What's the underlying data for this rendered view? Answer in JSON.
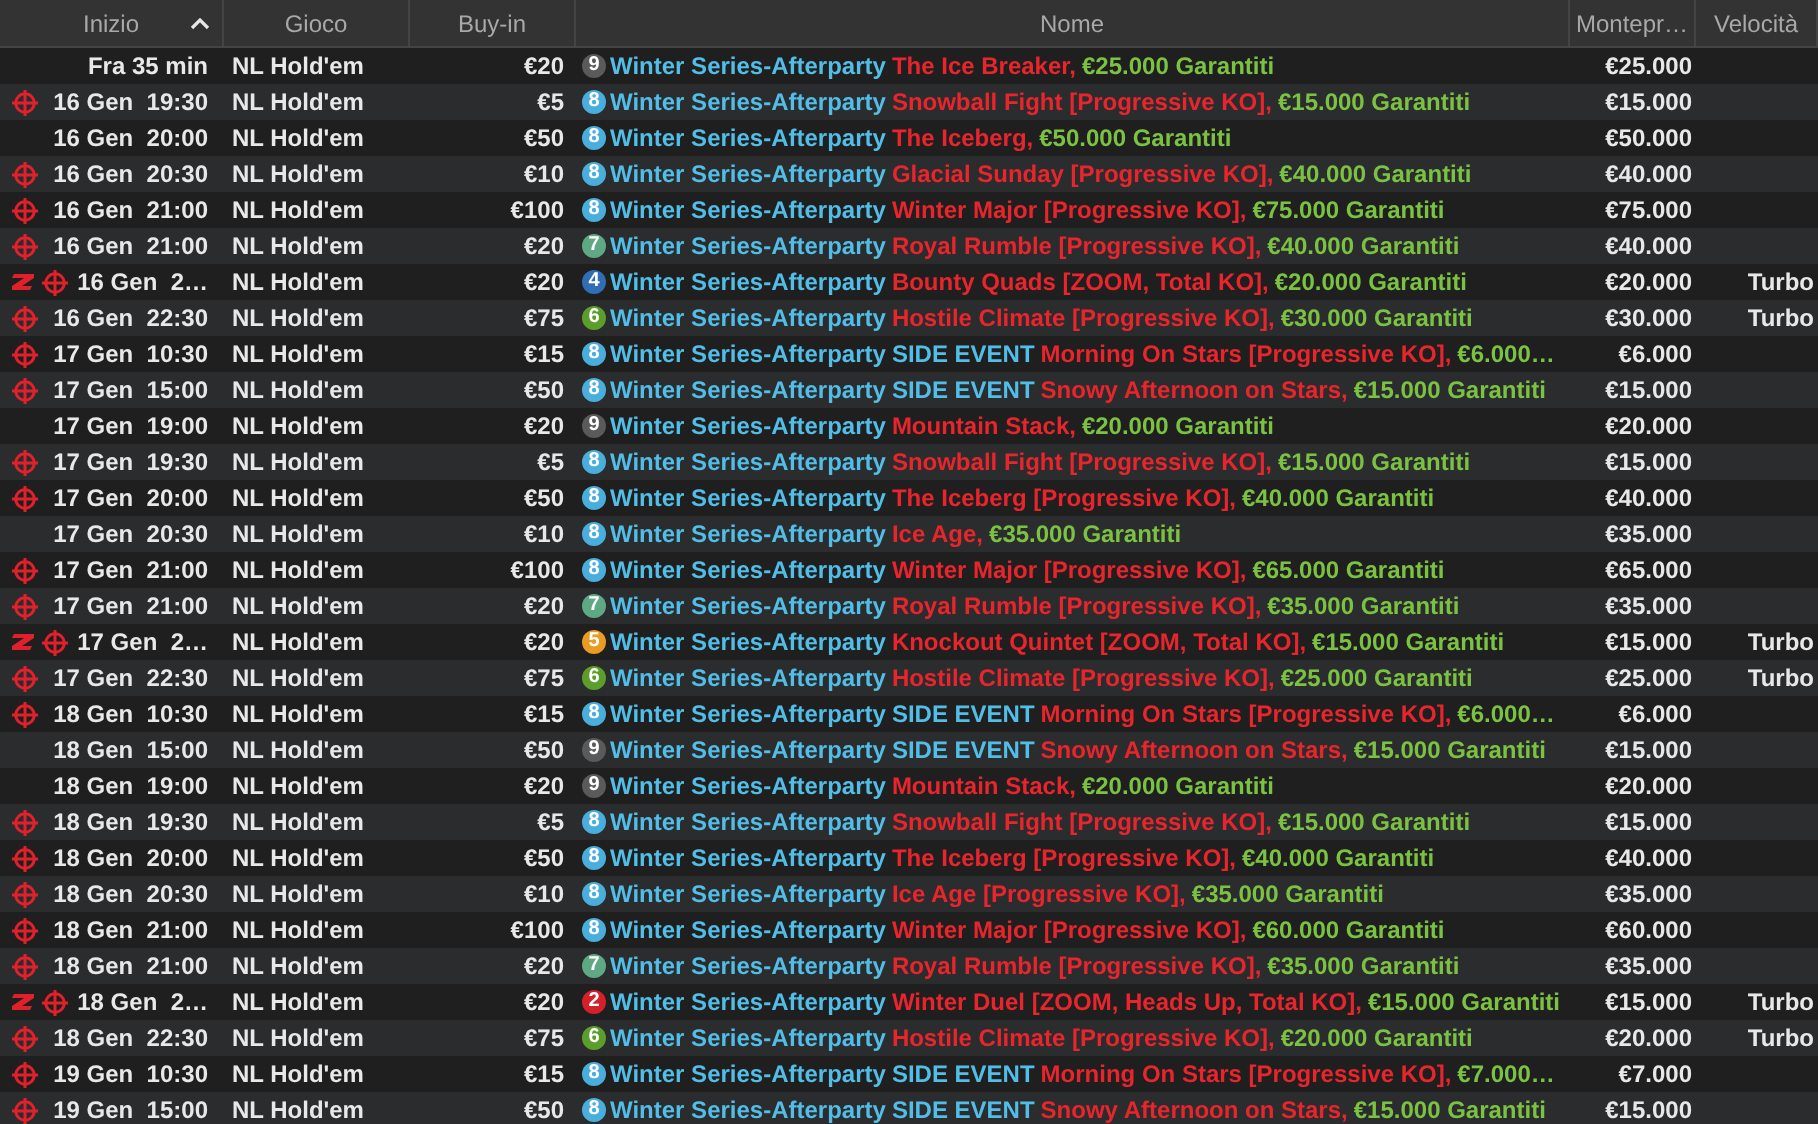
{
  "columns": [
    {
      "label": "Inizio",
      "sorted": true
    },
    {
      "label": "Gioco"
    },
    {
      "label": "Buy-in"
    },
    {
      "label": "Nome"
    },
    {
      "label": "Montepr…"
    },
    {
      "label": "Velocità"
    }
  ],
  "rows": [
    {
      "start": "Fra 35 min",
      "target": false,
      "zoom": false,
      "game": "NL Hold'em",
      "buyin": "€20",
      "badge": "9",
      "color": "#5a5a5a",
      "series": "Winter Series-Afterparty",
      "title": "The Ice Breaker,",
      "guarantee": "€25.000 Garantiti",
      "prize": "€25.000"
    },
    {
      "start": "16 Gen  19:30",
      "target": true,
      "zoom": false,
      "game": "NL Hold'em",
      "buyin": "€5",
      "badge": "8",
      "color": "#4aaedc",
      "series": "Winter Series-Afterparty",
      "title": "Snowball Fight [Progressive KO],",
      "guarantee": "€15.000 Garantiti",
      "prize": "€15.000"
    },
    {
      "start": "16 Gen  20:00",
      "target": false,
      "zoom": false,
      "game": "NL Hold'em",
      "buyin": "€50",
      "badge": "8",
      "color": "#4aaedc",
      "series": "Winter Series-Afterparty",
      "title": "The Iceberg,",
      "guarantee": "€50.000 Garantiti",
      "prize": "€50.000"
    },
    {
      "start": "16 Gen  20:30",
      "target": true,
      "zoom": false,
      "game": "NL Hold'em",
      "buyin": "€10",
      "badge": "8",
      "color": "#4aaedc",
      "series": "Winter Series-Afterparty",
      "title": "Glacial Sunday [Progressive KO],",
      "guarantee": "€40.000 Garantiti",
      "prize": "€40.000"
    },
    {
      "start": "16 Gen  21:00",
      "target": true,
      "zoom": false,
      "game": "NL Hold'em",
      "buyin": "€100",
      "badge": "8",
      "color": "#4aaedc",
      "series": "Winter Series-Afterparty",
      "title": "Winter Major [Progressive KO],",
      "guarantee": "€75.000 Garantiti",
      "prize": "€75.000"
    },
    {
      "start": "16 Gen  21:00",
      "target": true,
      "zoom": false,
      "game": "NL Hold'em",
      "buyin": "€20",
      "badge": "7",
      "color": "#5fa884",
      "series": "Winter Series-Afterparty",
      "title": "Royal Rumble [Progressive KO],",
      "guarantee": "€40.000 Garantiti",
      "prize": "€40.000"
    },
    {
      "start": "16 Gen  2…",
      "target": true,
      "zoom": true,
      "game": "NL Hold'em",
      "buyin": "€20",
      "badge": "4",
      "color": "#2f6eb5",
      "series": "Winter Series-Afterparty",
      "title": "Bounty Quads [ZOOM, Total KO],",
      "guarantee": "€20.000 Garantiti",
      "prize": "€20.000",
      "speed": "Turbo"
    },
    {
      "start": "16 Gen  22:30",
      "target": true,
      "zoom": false,
      "game": "NL Hold'em",
      "buyin": "€75",
      "badge": "6",
      "color": "#5c9e2c",
      "series": "Winter Series-Afterparty",
      "title": "Hostile Climate [Progressive KO],",
      "guarantee": "€30.000 Garantiti",
      "prize": "€30.000",
      "speed": "Turbo"
    },
    {
      "start": "17 Gen  10:30",
      "target": true,
      "zoom": false,
      "game": "NL Hold'em",
      "buyin": "€15",
      "badge": "8",
      "color": "#4aaedc",
      "series": "Winter Series-Afterparty",
      "event": "SIDE EVENT",
      "title": "Morning On Stars [Progressive KO],",
      "guarantee": "€6.000…",
      "prize": "€6.000"
    },
    {
      "start": "17 Gen  15:00",
      "target": true,
      "zoom": false,
      "game": "NL Hold'em",
      "buyin": "€50",
      "badge": "8",
      "color": "#4aaedc",
      "series": "Winter Series-Afterparty",
      "event": "SIDE EVENT",
      "title": "Snowy Afternoon on Stars,",
      "guarantee": "€15.000 Garantiti",
      "prize": "€15.000"
    },
    {
      "start": "17 Gen  19:00",
      "target": false,
      "zoom": false,
      "game": "NL Hold'em",
      "buyin": "€20",
      "badge": "9",
      "color": "#5a5a5a",
      "series": "Winter Series-Afterparty",
      "title": "Mountain Stack,",
      "guarantee": "€20.000 Garantiti",
      "prize": "€20.000"
    },
    {
      "start": "17 Gen  19:30",
      "target": true,
      "zoom": false,
      "game": "NL Hold'em",
      "buyin": "€5",
      "badge": "8",
      "color": "#4aaedc",
      "series": "Winter Series-Afterparty",
      "title": "Snowball Fight [Progressive KO],",
      "guarantee": "€15.000 Garantiti",
      "prize": "€15.000"
    },
    {
      "start": "17 Gen  20:00",
      "target": true,
      "zoom": false,
      "game": "NL Hold'em",
      "buyin": "€50",
      "badge": "8",
      "color": "#4aaedc",
      "series": "Winter Series-Afterparty",
      "title": "The Iceberg [Progressive KO],",
      "guarantee": "€40.000 Garantiti",
      "prize": "€40.000"
    },
    {
      "start": "17 Gen  20:30",
      "target": false,
      "zoom": false,
      "game": "NL Hold'em",
      "buyin": "€10",
      "badge": "8",
      "color": "#4aaedc",
      "series": "Winter Series-Afterparty",
      "title": "Ice Age,",
      "guarantee": "€35.000 Garantiti",
      "prize": "€35.000"
    },
    {
      "start": "17 Gen  21:00",
      "target": true,
      "zoom": false,
      "game": "NL Hold'em",
      "buyin": "€100",
      "badge": "8",
      "color": "#4aaedc",
      "series": "Winter Series-Afterparty",
      "title": "Winter Major [Progressive KO],",
      "guarantee": "€65.000 Garantiti",
      "prize": "€65.000"
    },
    {
      "start": "17 Gen  21:00",
      "target": true,
      "zoom": false,
      "game": "NL Hold'em",
      "buyin": "€20",
      "badge": "7",
      "color": "#5fa884",
      "series": "Winter Series-Afterparty",
      "title": "Royal Rumble [Progressive KO],",
      "guarantee": "€35.000 Garantiti",
      "prize": "€35.000"
    },
    {
      "start": "17 Gen  2…",
      "target": true,
      "zoom": true,
      "game": "NL Hold'em",
      "buyin": "€20",
      "badge": "5",
      "color": "#e99b22",
      "series": "Winter Series-Afterparty",
      "title": "Knockout Quintet [ZOOM, Total KO],",
      "guarantee": "€15.000 Garantiti",
      "prize": "€15.000",
      "speed": "Turbo"
    },
    {
      "start": "17 Gen  22:30",
      "target": true,
      "zoom": false,
      "game": "NL Hold'em",
      "buyin": "€75",
      "badge": "6",
      "color": "#5c9e2c",
      "series": "Winter Series-Afterparty",
      "title": "Hostile Climate [Progressive KO],",
      "guarantee": "€25.000 Garantiti",
      "prize": "€25.000",
      "speed": "Turbo"
    },
    {
      "start": "18 Gen  10:30",
      "target": true,
      "zoom": false,
      "game": "NL Hold'em",
      "buyin": "€15",
      "badge": "8",
      "color": "#4aaedc",
      "series": "Winter Series-Afterparty",
      "event": "SIDE EVENT",
      "title": "Morning On Stars [Progressive KO],",
      "guarantee": "€6.000…",
      "prize": "€6.000"
    },
    {
      "start": "18 Gen  15:00",
      "target": false,
      "zoom": false,
      "game": "NL Hold'em",
      "buyin": "€50",
      "badge": "9",
      "color": "#5a5a5a",
      "series": "Winter Series-Afterparty",
      "event": "SIDE EVENT",
      "title": "Snowy Afternoon on Stars,",
      "guarantee": "€15.000 Garantiti",
      "prize": "€15.000"
    },
    {
      "start": "18 Gen  19:00",
      "target": false,
      "zoom": false,
      "game": "NL Hold'em",
      "buyin": "€20",
      "badge": "9",
      "color": "#5a5a5a",
      "series": "Winter Series-Afterparty",
      "title": "Mountain Stack,",
      "guarantee": "€20.000 Garantiti",
      "prize": "€20.000"
    },
    {
      "start": "18 Gen  19:30",
      "target": true,
      "zoom": false,
      "game": "NL Hold'em",
      "buyin": "€5",
      "badge": "8",
      "color": "#4aaedc",
      "series": "Winter Series-Afterparty",
      "title": "Snowball Fight [Progressive KO],",
      "guarantee": "€15.000 Garantiti",
      "prize": "€15.000"
    },
    {
      "start": "18 Gen  20:00",
      "target": true,
      "zoom": false,
      "game": "NL Hold'em",
      "buyin": "€50",
      "badge": "8",
      "color": "#4aaedc",
      "series": "Winter Series-Afterparty",
      "title": "The Iceberg [Progressive KO],",
      "guarantee": "€40.000 Garantiti",
      "prize": "€40.000"
    },
    {
      "start": "18 Gen  20:30",
      "target": true,
      "zoom": false,
      "game": "NL Hold'em",
      "buyin": "€10",
      "badge": "8",
      "color": "#4aaedc",
      "series": "Winter Series-Afterparty",
      "title": "Ice Age [Progressive KO],",
      "guarantee": "€35.000 Garantiti",
      "prize": "€35.000"
    },
    {
      "start": "18 Gen  21:00",
      "target": true,
      "zoom": false,
      "game": "NL Hold'em",
      "buyin": "€100",
      "badge": "8",
      "color": "#4aaedc",
      "series": "Winter Series-Afterparty",
      "title": "Winter Major [Progressive KO],",
      "guarantee": "€60.000 Garantiti",
      "prize": "€60.000"
    },
    {
      "start": "18 Gen  21:00",
      "target": true,
      "zoom": false,
      "game": "NL Hold'em",
      "buyin": "€20",
      "badge": "7",
      "color": "#5fa884",
      "series": "Winter Series-Afterparty",
      "title": "Royal Rumble [Progressive KO],",
      "guarantee": "€35.000 Garantiti",
      "prize": "€35.000"
    },
    {
      "start": "18 Gen  2…",
      "target": true,
      "zoom": true,
      "game": "NL Hold'em",
      "buyin": "€20",
      "badge": "2",
      "color": "#d3202b",
      "series": "Winter Series-Afterparty",
      "title": "Winter Duel [ZOOM, Heads Up, Total KO],",
      "guarantee": "€15.000 Garantiti",
      "prize": "€15.000",
      "speed": "Turbo"
    },
    {
      "start": "18 Gen  22:30",
      "target": true,
      "zoom": false,
      "game": "NL Hold'em",
      "buyin": "€75",
      "badge": "6",
      "color": "#5c9e2c",
      "series": "Winter Series-Afterparty",
      "title": "Hostile Climate [Progressive KO],",
      "guarantee": "€20.000 Garantiti",
      "prize": "€20.000",
      "speed": "Turbo"
    },
    {
      "start": "19 Gen  10:30",
      "target": true,
      "zoom": false,
      "game": "NL Hold'em",
      "buyin": "€15",
      "badge": "8",
      "color": "#4aaedc",
      "series": "Winter Series-Afterparty",
      "event": "SIDE EVENT",
      "title": "Morning On Stars [Progressive KO],",
      "guarantee": "€7.000…",
      "prize": "€7.000"
    },
    {
      "start": "19 Gen  15:00",
      "target": true,
      "zoom": false,
      "game": "NL Hold'em",
      "buyin": "€50",
      "badge": "8",
      "color": "#4aaedc",
      "series": "Winter Series-Afterparty",
      "event": "SIDE EVENT",
      "title": "Snowy Afternoon on Stars,",
      "guarantee": "€15.000 Garantiti",
      "prize": "€15.000"
    }
  ]
}
